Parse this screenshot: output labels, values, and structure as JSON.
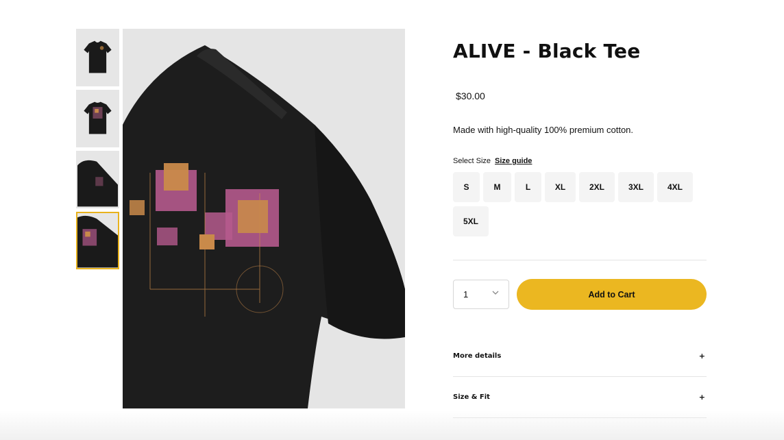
{
  "product": {
    "title": "ALIVE - Black Tee",
    "price": "$30.00",
    "description": "Made with high-quality 100% premium cotton."
  },
  "size_select": {
    "label": "Select Size",
    "guide_label": "Size guide",
    "options": [
      "S",
      "M",
      "L",
      "XL",
      "2XL",
      "3XL",
      "4XL",
      "5XL"
    ]
  },
  "quantity": {
    "value": "1",
    "chevron_icon": "chevron-down-icon"
  },
  "cart": {
    "add_label": "Add to Cart",
    "button_color": "#ebb721"
  },
  "accordion": [
    {
      "label": "More details",
      "icon": "+"
    },
    {
      "label": "Size & Fit",
      "icon": "+"
    }
  ],
  "gallery": {
    "selected_index": 3,
    "accent_color": "#e8b21c",
    "thumbnail_count": 4
  }
}
